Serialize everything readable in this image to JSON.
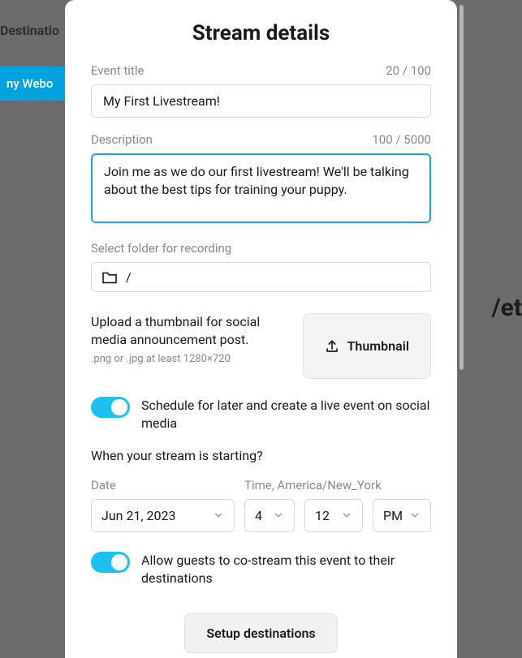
{
  "background": {
    "navItem": "Destinatio",
    "buttonText": "ny Webo",
    "bigText": "/et"
  },
  "modal": {
    "title": "Stream details",
    "eventTitle": {
      "label": "Event title",
      "counter": "20 / 100",
      "value": "My First Livestream!"
    },
    "description": {
      "label": "Description",
      "counter": "100 / 5000",
      "value": "Join me as we do our first livestream! We'll be talking about the best tips for training your puppy."
    },
    "folder": {
      "label": "Select folder for recording",
      "value": "/"
    },
    "thumbnail": {
      "text": "Upload a thumbnail for social media announcement post.",
      "hint": ".png or .jpg at least 1280×720",
      "buttonLabel": "Thumbnail"
    },
    "scheduleToggle": {
      "label": "Schedule for later and create a live event on social media"
    },
    "startHeading": "When your stream is starting?",
    "date": {
      "label": "Date",
      "value": "Jun 21, 2023"
    },
    "time": {
      "label": "Time, America/New_York",
      "hour": "4",
      "minute": "12",
      "ampm": "PM"
    },
    "guestsToggle": {
      "label": "Allow guests to co-stream this event to their destinations"
    },
    "footerButton": "Setup destinations"
  }
}
